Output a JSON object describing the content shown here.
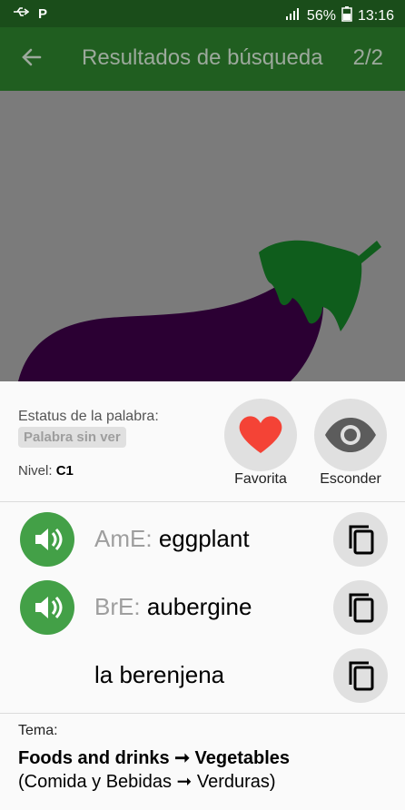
{
  "statusbar": {
    "battery": "56%",
    "time": "13:16"
  },
  "appbar": {
    "title": "Resultados de búsqueda",
    "counter": "2/2"
  },
  "word_status": {
    "label": "Estatus de la palabra:",
    "value": "Palabra sin ver",
    "level_label": "Nivel:",
    "level_value": "C1"
  },
  "actions": {
    "favorite_label": "Favorita",
    "hide_label": "Esconder"
  },
  "pronunciations": [
    {
      "prefix": "AmE:",
      "word": "eggplant"
    },
    {
      "prefix": "BrE:",
      "word": "aubergine"
    }
  ],
  "translation": "la berenjena",
  "topic": {
    "label": "Tema:",
    "main": "Foods and drinks ➞ Vegetables",
    "sub": "(Comida y Bebidas ➞ Verduras)"
  },
  "colors": {
    "appbar": "#205e20",
    "statusbar": "#1a4d1a",
    "speaker": "#43a047",
    "heart": "#f44336",
    "eggplant": "#2b0033"
  },
  "icons": [
    "usb-icon",
    "parking-icon",
    "signal-icon",
    "battery-icon",
    "back-arrow-icon",
    "heart-icon",
    "eye-icon",
    "speaker-icon",
    "copy-icon"
  ]
}
